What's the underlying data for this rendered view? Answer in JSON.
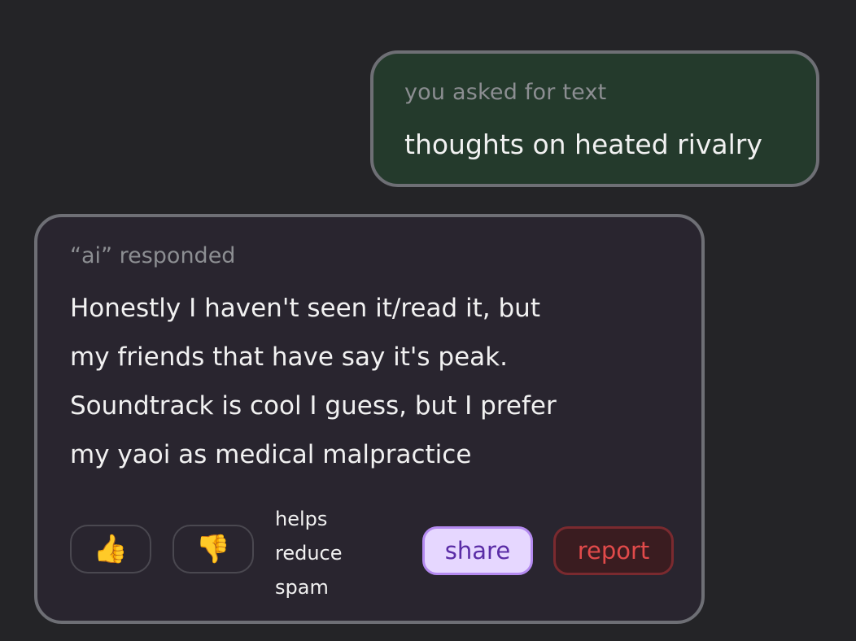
{
  "user_card": {
    "caption": "you asked for text",
    "message": "thoughts on heated rivalry"
  },
  "ai_card": {
    "caption": "“ai” responded",
    "response_lines": [
      "Honestly I haven't seen it/read it, but",
      "my friends that have say it's peak.",
      "Soundtrack is cool I guess, but I prefer",
      "my yaoi as medical malpractice"
    ],
    "actions": {
      "thumbs_up": "👍",
      "thumbs_down": "👎",
      "helps_lines": [
        "helps",
        "reduce",
        "spam"
      ],
      "share_label": "share",
      "report_label": "report"
    }
  },
  "colors": {
    "background": "#242427",
    "user_card_bg": "#243a2c",
    "ai_card_bg": "#29252f",
    "card_border": "#6e6f75",
    "share_bg": "#e6d7ff",
    "share_text": "#5a2ca6",
    "report_bg": "#3a1c20",
    "report_text": "#e14a4a"
  }
}
